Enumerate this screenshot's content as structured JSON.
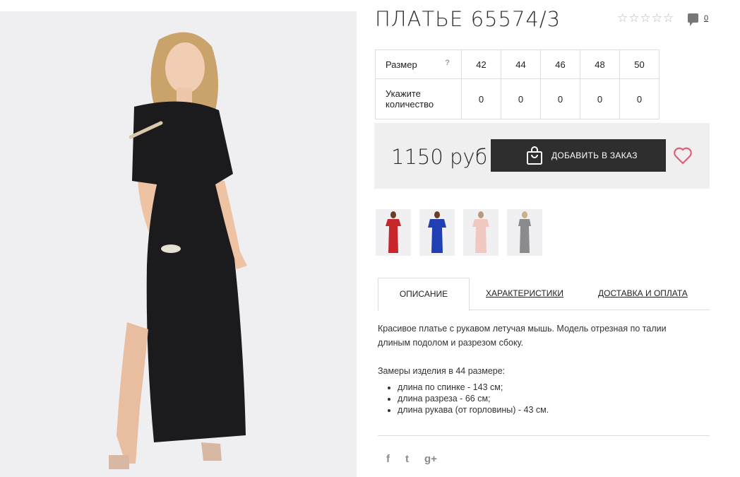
{
  "product": {
    "title": "ПЛАТЬЕ 65574/3",
    "rating_stars": [
      "☆",
      "☆",
      "☆",
      "☆",
      "☆"
    ],
    "comments_count": "0"
  },
  "size_table": {
    "size_label": "Размер",
    "help_mark": "?",
    "sizes": [
      "42",
      "44",
      "46",
      "48",
      "50"
    ],
    "qty_label_line1": "Укажите",
    "qty_label_line2": "количество",
    "quantities": [
      "0",
      "0",
      "0",
      "0",
      "0"
    ]
  },
  "price": {
    "value": "1150 руб",
    "order_button": "ДОБАВИТЬ В ЗАКАЗ"
  },
  "thumbnails": [
    {
      "name": "red-dress",
      "color": "#c8262a"
    },
    {
      "name": "blue-dress",
      "color": "#1f3fb3"
    },
    {
      "name": "pink-dress",
      "color": "#efc9c0"
    },
    {
      "name": "grey-dress",
      "color": "#8b8b8d"
    }
  ],
  "tabs": [
    "ОПИСАНИЕ",
    "ХАРАКТЕРИСТИКИ",
    "ДОСТАВКА И ОПЛАТА"
  ],
  "description": {
    "text_line1": "Красивое платье с рукавом летучая мышь. Модель отрезная по талии",
    "text_line2": "длиным подолом и разрезом сбоку.",
    "measure_title": "Замеры изделия в 44 размере:",
    "measures": [
      "длина по спинке - 143 см;",
      "длина разреза - 66 см;",
      "длина рукава (от горловины) - 43 см."
    ]
  },
  "social": {
    "facebook": "f",
    "twitter": "t",
    "googleplus": "g+"
  },
  "colors": {
    "button_bg": "#2e2e2e",
    "heart": "#e0607a",
    "price_box_bg": "#efefef"
  }
}
